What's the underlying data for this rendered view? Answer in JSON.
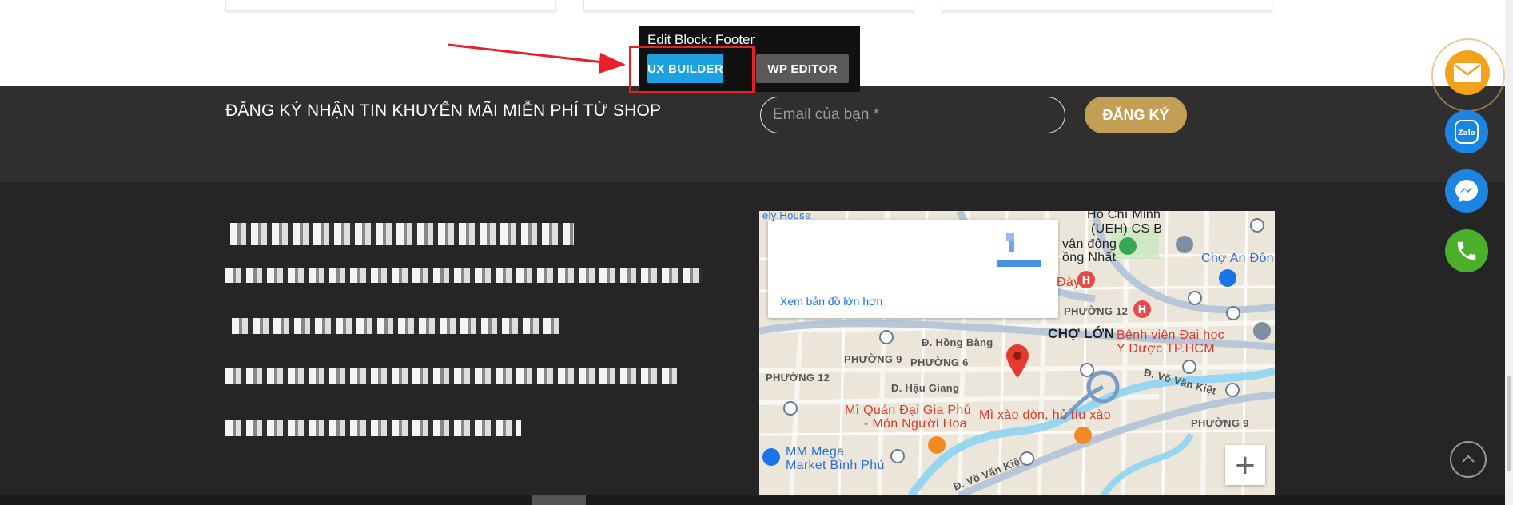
{
  "newsletter": {
    "title": "ĐĂNG KÝ NHẬN TIN KHUYẾN MÃI MIỄN PHÍ TỪ SHOP",
    "email_placeholder": "Email của bạn *",
    "subscribe_label": "ĐĂNG KÝ"
  },
  "edit_block": {
    "title": "Edit Block: Footer",
    "ux_builder_label": "UX BUILDER",
    "wp_editor_label": "WP EDITOR"
  },
  "map": {
    "larger_map_link": "Xem bản đồ lớn hơn",
    "zoom_in_label": "+",
    "labels": {
      "ho_chi_minh": "Hồ Chí Minh",
      "ueh": "(UEH) CS B",
      "van_dong": "vận động",
      "dong_nhat": "ồng Nhất",
      "cho_an_dong": "Chợ An Đôn",
      "day": "Đày",
      "phuong_12_top": "PHƯỜNG 12",
      "cho_lon": "CHỢ LỚN",
      "benh_vien": "Bệnh viện Đại học",
      "y_duoc": "Y Dược TP.HCM",
      "hong_bang": "Đ. Hồng Bàng",
      "phuong_9": "PHƯỜNG 9",
      "phuong_6": "PHƯỜNG 6",
      "phuong_12_left": "PHƯỜNG 12",
      "hau_giang": "Đ. Hậu Giang",
      "vo_van_kiet": "Đ. Võ Văn Kiệt",
      "vo_van_kiet_2": "Đ. Võ Văn Kiệt",
      "mi_quan": "Mì Quán Đại Gia Phú",
      "mon_nguoi_hoa": "- Món Người Hoa",
      "mi_xao": "Mì xào dòn, hủ tíu xào",
      "phuong_9_right": "PHƯỜNG 9",
      "mm_mega": "MM Mega",
      "market_binh_phu": "Market Bình Phú",
      "ely_house": "ely House"
    }
  },
  "floating_contacts": {
    "zalo_label": "Zalo"
  },
  "colors": {
    "accent_gold": "#c39f55",
    "ux_builder_blue": "#1ea1e0",
    "highlight_red": "#e8202a",
    "footer_dark": "#252525"
  }
}
